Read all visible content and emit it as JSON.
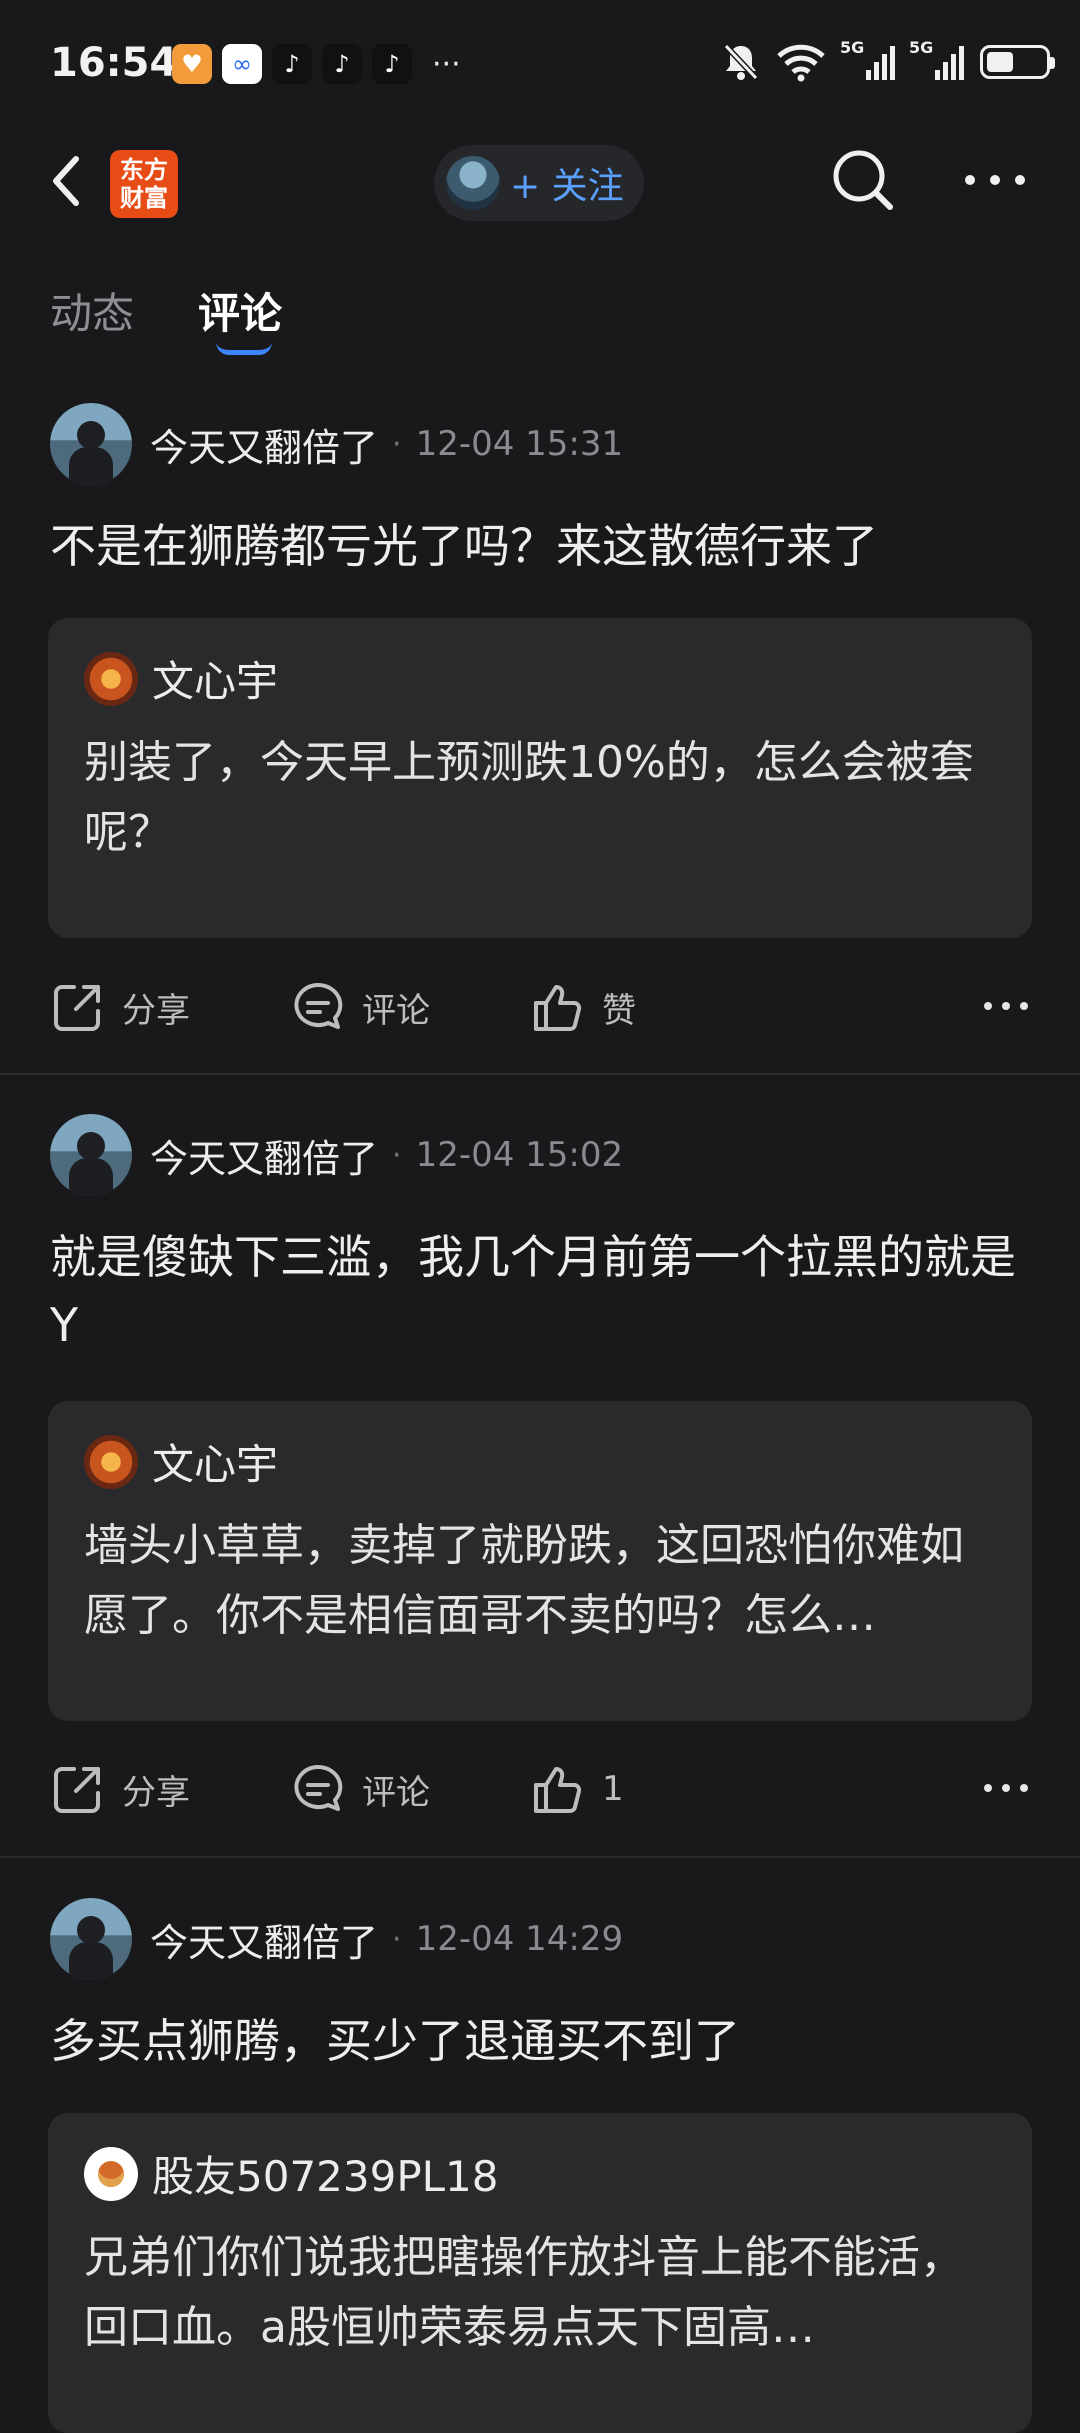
{
  "status_bar": {
    "time": "16:54",
    "apps": [
      {
        "icon": "heart-app-icon",
        "color": "#f39a3a"
      },
      {
        "icon": "link-app-icon",
        "color": "#ffffff"
      },
      {
        "icon": "tiktok-icon",
        "color": "#111111"
      },
      {
        "icon": "tiktok-icon",
        "color": "#111111"
      },
      {
        "icon": "tiktok-icon",
        "color": "#111111"
      }
    ],
    "more": "···",
    "net1": "5G",
    "net2": "5G"
  },
  "nav": {
    "logo_line1": "东方",
    "logo_line2": "财富",
    "follow_label": "+ 关注"
  },
  "tabs": [
    {
      "label": "动态"
    },
    {
      "label": "评论"
    }
  ],
  "posts": [
    {
      "author": "今天又翻倍了",
      "time": "12-04 15:31",
      "text": "不是在狮腾都亏光了吗？来这散德行来了",
      "quote": {
        "author": "文心宇",
        "text": "别装了，今天早上预测跌10%的，怎么会被套呢？"
      },
      "share": "分享",
      "comment": "评论",
      "like": "赞"
    },
    {
      "author": "今天又翻倍了",
      "time": "12-04 15:02",
      "text": "就是傻缺下三滥，我几个月前第一个拉黑的就是Y",
      "quote": {
        "author": "文心宇",
        "text": "墙头小草草，卖掉了就盼跌，这回恐怕你难如愿了。你不是相信面哥不卖的吗？怎么…"
      },
      "share": "分享",
      "comment": "评论",
      "like": "1"
    },
    {
      "author": "今天又翻倍了",
      "time": "12-04 14:29",
      "text": "多买点狮腾，买少了退通买不到了",
      "quote": {
        "author": "股友507239PL18",
        "text": "兄弟们你们说我把瞎操作放抖音上能不能活，回口血。a股恒帅荣泰易点天下固高…"
      }
    }
  ]
}
